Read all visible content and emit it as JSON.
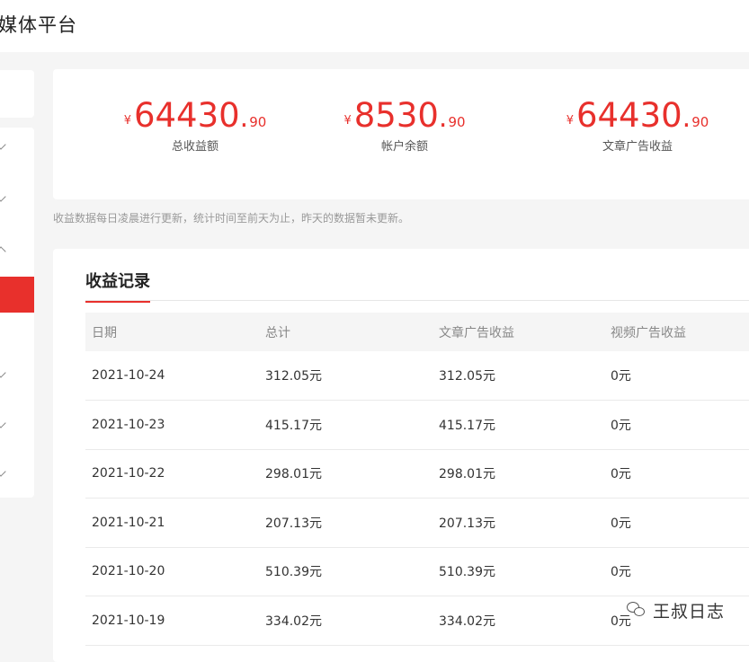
{
  "header": {
    "title": "媒体平台"
  },
  "sidebar": {
    "items": [
      {
        "caret": "down"
      },
      {
        "caret": "down"
      },
      {
        "caret": "up"
      },
      {
        "active": true
      },
      {
        "caret": "none"
      },
      {
        "caret": "down"
      },
      {
        "caret": "down"
      },
      {
        "caret": "down"
      }
    ]
  },
  "stats": [
    {
      "currency": "¥",
      "integer": "64430",
      "dot": ".",
      "decimal": "90",
      "label": "总收益额"
    },
    {
      "currency": "¥",
      "integer": "8530",
      "dot": ".",
      "decimal": "90",
      "label": "帐户余额"
    },
    {
      "currency": "¥",
      "integer": "64430",
      "dot": ".",
      "decimal": "90",
      "label": "文章广告收益"
    }
  ],
  "note": "收益数据每日凌晨进行更新，统计时间至前天为止，昨天的数据暂未更新。",
  "records": {
    "tab": "收益记录",
    "columns": [
      "日期",
      "总计",
      "文章广告收益",
      "视频广告收益"
    ],
    "rows": [
      [
        "2021-10-24",
        "312.05元",
        "312.05元",
        "0元"
      ],
      [
        "2021-10-23",
        "415.17元",
        "415.17元",
        "0元"
      ],
      [
        "2021-10-22",
        "298.01元",
        "298.01元",
        "0元"
      ],
      [
        "2021-10-21",
        "207.13元",
        "207.13元",
        "0元"
      ],
      [
        "2021-10-20",
        "510.39元",
        "510.39元",
        "0元"
      ],
      [
        "2021-10-19",
        "334.02元",
        "334.02元",
        "0元"
      ]
    ]
  },
  "watermark": {
    "text": "王叔日志",
    "icon": "wechat-icon"
  },
  "colors": {
    "accent": "#e8302c",
    "background": "#f5f5f5"
  }
}
